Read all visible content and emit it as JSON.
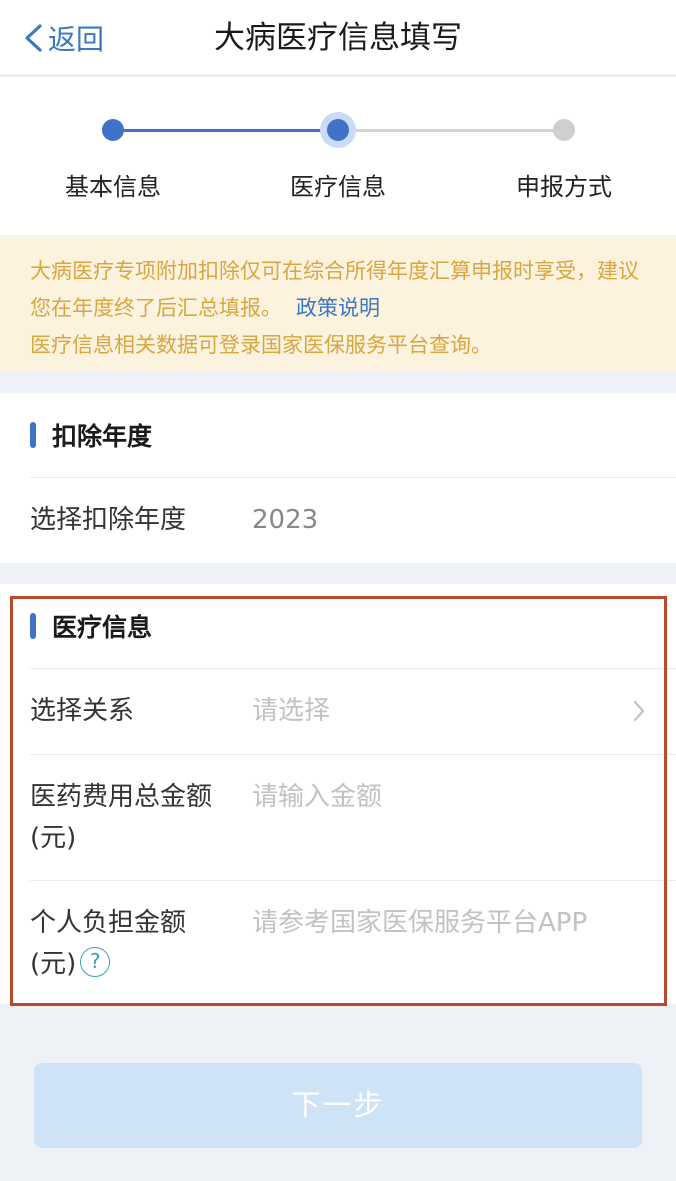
{
  "nav": {
    "back_label": "返回",
    "title": "大病医疗信息填写"
  },
  "steps": [
    {
      "label": "基本信息",
      "state": "done"
    },
    {
      "label": "医疗信息",
      "state": "current"
    },
    {
      "label": "申报方式",
      "state": "pending"
    }
  ],
  "notice": {
    "text": "大病医疗专项附加扣除仅可在综合所得年度汇算申报时享受，建议您在年度终了后汇总填报。",
    "link": "政策说明",
    "line2": "医疗信息相关数据可登录国家医保服务平台查询。"
  },
  "year_section": {
    "title": "扣除年度",
    "row_label": "选择扣除年度",
    "row_value": "2023"
  },
  "medical_section": {
    "title": "医疗信息",
    "relation_label": "选择关系",
    "relation_placeholder": "请选择",
    "total_label": "医药费用总金额(元)",
    "total_placeholder": "请输入金额",
    "personal_label": "个人负担金额(元)",
    "personal_placeholder": "请参考国家医保服务平台APP"
  },
  "next_button": "下一步",
  "colors": {
    "primary": "#3f72c8",
    "notice_bg": "#fcf3df",
    "notice_text": "#d9a640",
    "highlight": "#b94a2c",
    "button_disabled": "#cfe3f6"
  }
}
